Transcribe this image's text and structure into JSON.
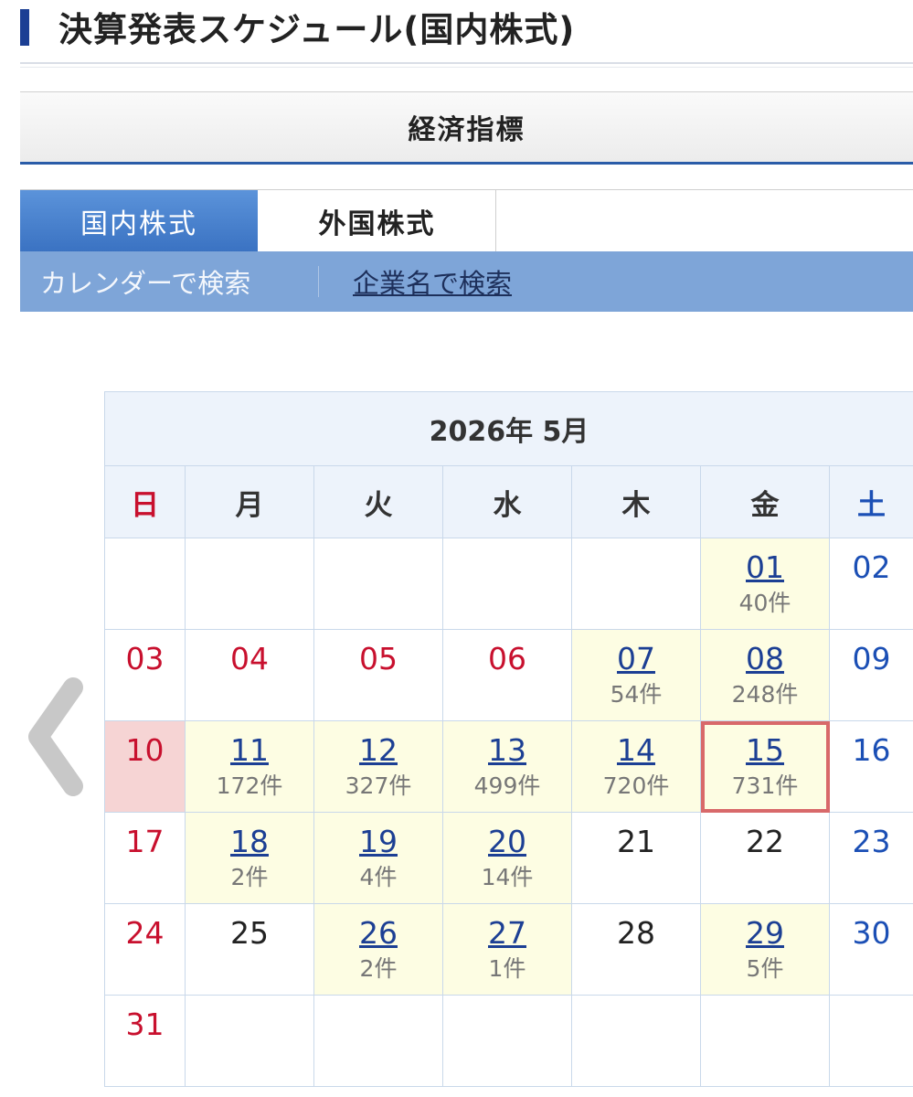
{
  "header": {
    "title": "決算発表スケジュール(国内株式)"
  },
  "econ_tab": {
    "label": "経済指標"
  },
  "market_tabs": [
    {
      "label": "国内株式",
      "active": true
    },
    {
      "label": "外国株式",
      "active": false
    }
  ],
  "search_modes": {
    "current": "カレンダーで検索",
    "link": "企業名で検索"
  },
  "nav": {
    "prev_icon": "chevron-left-icon"
  },
  "calendar": {
    "caption": "2026年 5月",
    "weekdays": [
      "日",
      "月",
      "火",
      "水",
      "木",
      "金",
      "土"
    ],
    "colors": {
      "sunday": "#c8102e",
      "saturday": "#1b4fb5",
      "event_bg": "#fdfde3",
      "selected_border": "#d8696a",
      "link": "#1c3f94"
    },
    "weeks": [
      [
        null,
        null,
        null,
        null,
        null,
        {
          "day": "01",
          "count": "40件"
        },
        {
          "day": "02"
        }
      ],
      [
        {
          "day": "03",
          "holiday": true
        },
        {
          "day": "04",
          "holiday": true
        },
        {
          "day": "05",
          "holiday": true
        },
        {
          "day": "06",
          "holiday": true
        },
        {
          "day": "07",
          "count": "54件"
        },
        {
          "day": "08",
          "count": "248件"
        },
        {
          "day": "09"
        }
      ],
      [
        {
          "day": "10",
          "today_bg": true
        },
        {
          "day": "11",
          "count": "172件"
        },
        {
          "day": "12",
          "count": "327件"
        },
        {
          "day": "13",
          "count": "499件"
        },
        {
          "day": "14",
          "count": "720件"
        },
        {
          "day": "15",
          "count": "731件",
          "selected": true
        },
        {
          "day": "16"
        }
      ],
      [
        {
          "day": "17"
        },
        {
          "day": "18",
          "count": "2件"
        },
        {
          "day": "19",
          "count": "4件"
        },
        {
          "day": "20",
          "count": "14件"
        },
        {
          "day": "21"
        },
        {
          "day": "22"
        },
        {
          "day": "23"
        }
      ],
      [
        {
          "day": "24"
        },
        {
          "day": "25"
        },
        {
          "day": "26",
          "count": "2件"
        },
        {
          "day": "27",
          "count": "1件"
        },
        {
          "day": "28"
        },
        {
          "day": "29",
          "count": "5件"
        },
        {
          "day": "30"
        }
      ],
      [
        {
          "day": "31"
        },
        null,
        null,
        null,
        null,
        null,
        null
      ]
    ]
  }
}
